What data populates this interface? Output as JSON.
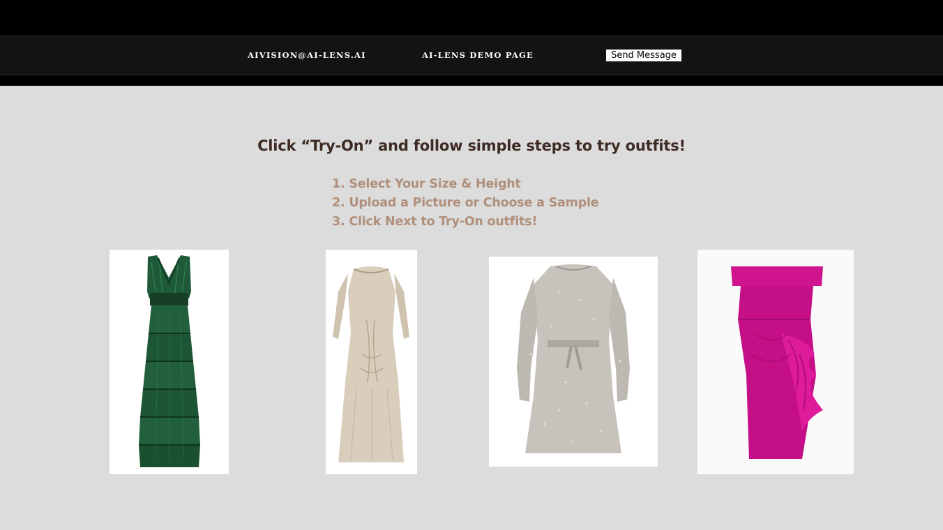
{
  "nav": {
    "email": "AIVISION@AI-LENS.AI",
    "demo_page": "AI-LENS DEMO PAGE",
    "send_message": "Send Message"
  },
  "main": {
    "headline": "Click “Try-On” and follow simple steps to try outfits!",
    "steps": [
      "1. Select Your Size & Height",
      "2. Upload a Picture or Choose a Sample",
      "3. Click Next to Try-On outfits!"
    ]
  },
  "outfits": [
    {
      "icon": "green-velvet-tiered-gown",
      "color": "#1f5a38"
    },
    {
      "icon": "champagne-long-sleeve-gown",
      "color": "#d9cdbc"
    },
    {
      "icon": "silver-sequin-mini-dress",
      "color": "#c7c2bc"
    },
    {
      "icon": "magenta-off-shoulder-dress",
      "color": "#d0138f"
    }
  ],
  "colors": {
    "top_band": "#000000",
    "nav_background": "#131313",
    "page_background": "#dcdcdc",
    "headline": "#3d2a22",
    "steps": "#b0907c"
  }
}
